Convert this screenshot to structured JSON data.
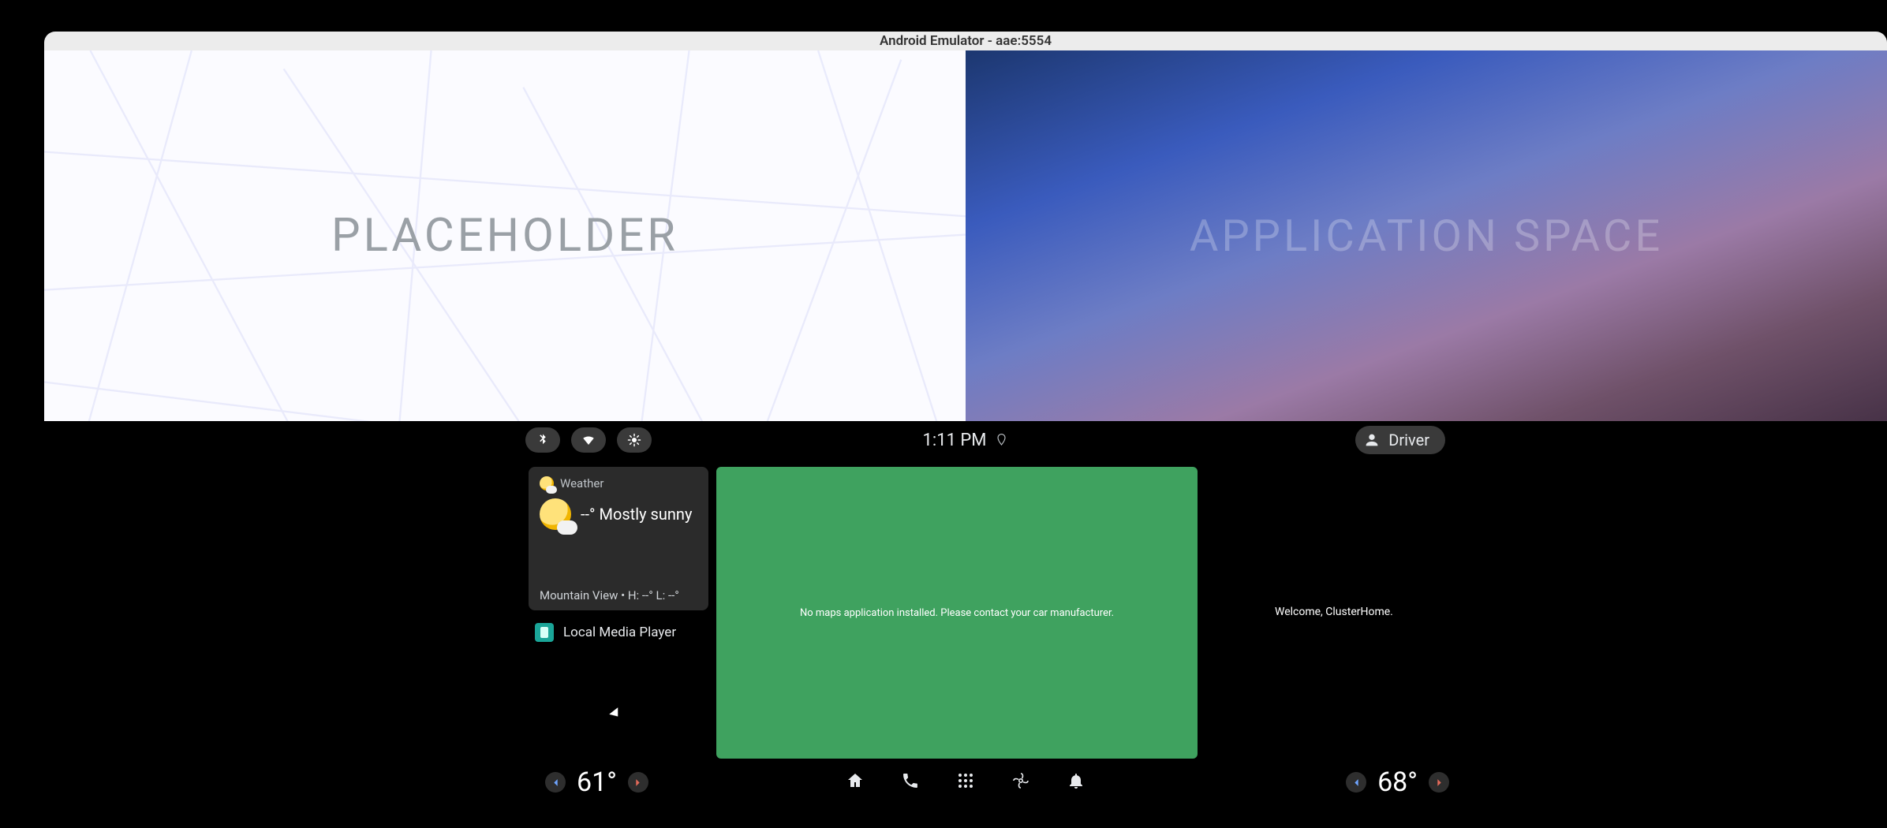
{
  "emulator": {
    "title": "Android Emulator - aae:5554",
    "panel_icons": [
      "close",
      "minimize",
      "power",
      "volume-up",
      "volume-down",
      "camera",
      "zoom-in",
      "circle",
      "more"
    ]
  },
  "cluster": {
    "left_label": "PLACEHOLDER",
    "right_label": "APPLICATION SPACE"
  },
  "statusbar": {
    "chips": [
      "bluetooth",
      "wifi",
      "brightness"
    ],
    "time": "1:11 PM",
    "location_icon": "location",
    "profile": {
      "icon": "person",
      "name": "Driver"
    }
  },
  "weather": {
    "header": "Weather",
    "summary": "--° Mostly sunny",
    "footer": "Mountain View • H: --° L: --°"
  },
  "media": {
    "label": "Local Media Player"
  },
  "map_panel": {
    "message": "No maps application installed. Please contact your car manufacturer."
  },
  "cluster_home": {
    "welcome": "Welcome, ClusterHome."
  },
  "navbar": {
    "icons": [
      "home",
      "phone",
      "apps",
      "fan",
      "bell"
    ]
  },
  "hvac": {
    "left_temp": "61°",
    "right_temp": "68°"
  }
}
